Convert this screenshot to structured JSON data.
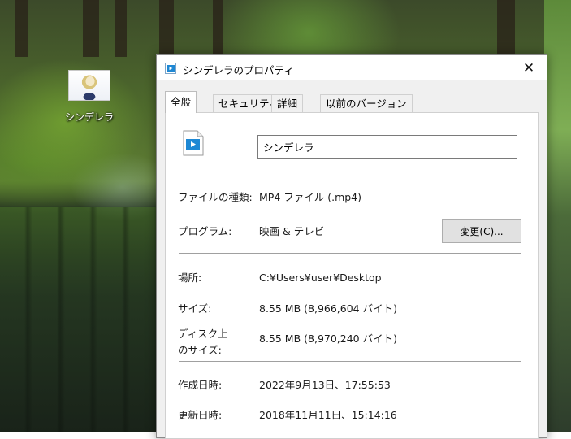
{
  "desktop": {
    "icon_label": "シンデレラ"
  },
  "window": {
    "title": "シンデレラのプロパティ",
    "close_label": "✕",
    "tabs": [
      {
        "label": "全般",
        "active": true
      },
      {
        "label": "セキュリティ",
        "active": false
      },
      {
        "label": "詳細",
        "active": false
      },
      {
        "label": "以前のバージョン",
        "active": false
      }
    ],
    "file_name": "シンデレラ",
    "rows": {
      "file_type": {
        "label": "ファイルの種類:",
        "value": "MP4 ファイル (.mp4)"
      },
      "program": {
        "label": "プログラム:",
        "value": "映画 & テレビ",
        "button": "変更(C)..."
      },
      "location": {
        "label": "場所:",
        "value": "C:¥Users¥user¥Desktop"
      },
      "size": {
        "label": "サイズ:",
        "value": "8.55 MB (8,966,604 バイト)"
      },
      "disk_size": {
        "label_line1": "ディスク上",
        "label_line2": "のサイズ:",
        "value": "8.55 MB (8,970,240 バイト)"
      },
      "created": {
        "label": "作成日時:",
        "value": "2022年9月13日、17:55:53"
      },
      "modified": {
        "label": "更新日時:",
        "value": "2018年11月11日、15:14:16"
      }
    }
  },
  "icons": {
    "title": "video-file-icon",
    "file": "video-file-icon",
    "close": "close-icon"
  },
  "colors": {
    "accent_blue": "#1e88d4",
    "window_bg": "#f0f0f0",
    "panel_bg": "#ffffff"
  }
}
